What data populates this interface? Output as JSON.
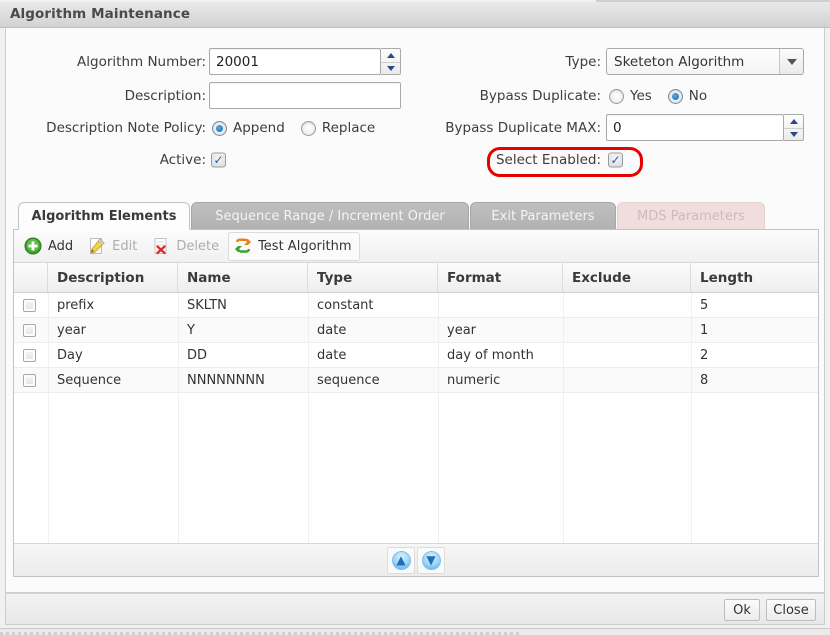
{
  "window": {
    "title": "Algorithm Maintenance"
  },
  "form": {
    "algorithm_number": {
      "label": "Algorithm Number:",
      "value": "20001"
    },
    "description": {
      "label": "Description:",
      "value": "",
      "placeholder": ""
    },
    "description_note_policy": {
      "label": "Description Note Policy:",
      "options": [
        "Append",
        "Replace"
      ],
      "selected": "Append"
    },
    "active": {
      "label": "Active:",
      "checked": true,
      "check_glyph": "✓"
    },
    "type": {
      "label": "Type:",
      "value": "Sketeton Algorithm"
    },
    "bypass_duplicate": {
      "label": "Bypass Duplicate:",
      "options": [
        "Yes",
        "No"
      ],
      "selected": "No"
    },
    "bypass_duplicate_max": {
      "label": "Bypass Duplicate MAX:",
      "value": "0"
    },
    "select_enabled": {
      "label": "Select Enabled:",
      "checked": true,
      "check_glyph": "✓",
      "annotation_color": "#e60000"
    }
  },
  "tabs": [
    {
      "label": "Algorithm Elements",
      "state": "active"
    },
    {
      "label": "Sequence Range / Increment Order",
      "state": "inactive"
    },
    {
      "label": "Exit Parameters",
      "state": "inactive"
    },
    {
      "label": "MDS Parameters",
      "state": "disabled"
    }
  ],
  "toolbar": [
    {
      "label": "Add",
      "icon": "plus-circle-icon",
      "enabled": true,
      "framed": false
    },
    {
      "label": "Edit",
      "icon": "pencil-icon",
      "enabled": false,
      "framed": false
    },
    {
      "label": "Delete",
      "icon": "delete-document-icon",
      "enabled": false,
      "framed": false
    },
    {
      "label": "Test Algorithm",
      "icon": "refresh-arrows-icon",
      "enabled": true,
      "framed": true
    }
  ],
  "table": {
    "columns": [
      "",
      "Description",
      "Name",
      "Type",
      "Format",
      "Exclude",
      "Length"
    ],
    "rows": [
      {
        "description": "prefix",
        "name": "SKLTN",
        "type": "constant",
        "format": "",
        "exclude": "",
        "length": "5",
        "selected": false
      },
      {
        "description": "year",
        "name": "Y",
        "type": "date",
        "format": "year",
        "exclude": "",
        "length": "1",
        "selected": false
      },
      {
        "description": "Day",
        "name": "DD",
        "type": "date",
        "format": "day of month",
        "exclude": "",
        "length": "2",
        "selected": false
      },
      {
        "description": "Sequence",
        "name": "NNNNNNNN",
        "type": "sequence",
        "format": "numeric",
        "exclude": "",
        "length": "8",
        "selected": false
      }
    ]
  },
  "reorder": {
    "move_up": {
      "label": "▲",
      "name": "move-up"
    },
    "move_down": {
      "label": "▼",
      "name": "move-down"
    }
  },
  "footer": {
    "ok_label": "Ok",
    "close_label": "Close"
  }
}
